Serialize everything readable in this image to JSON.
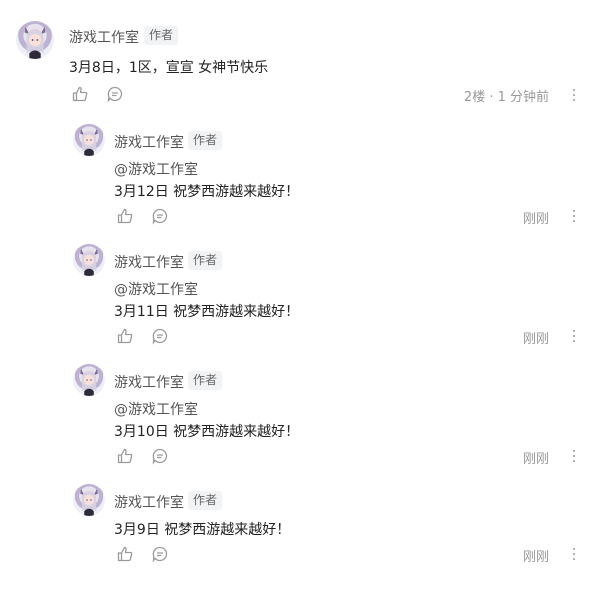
{
  "comments": [
    {
      "author": "游戏工作室",
      "badge": "作者",
      "mention": "",
      "text": "3月8日，1区，宣宣   女神节快乐",
      "meta": "2楼 · 1 分钟前",
      "icons": [
        "like-icon",
        "reply-icon",
        "more-options-icon"
      ]
    }
  ],
  "replies": [
    {
      "author": "游戏工作室",
      "badge": "作者",
      "mention": "@游戏工作室",
      "text": "3月12日  祝梦西游越来越好！",
      "meta": "刚刚"
    },
    {
      "author": "游戏工作室",
      "badge": "作者",
      "mention": "@游戏工作室",
      "text": "3月11日  祝梦西游越来越好！",
      "meta": "刚刚"
    },
    {
      "author": "游戏工作室",
      "badge": "作者",
      "mention": "@游戏工作室",
      "text": "3月10日  祝梦西游越来越好！",
      "meta": "刚刚"
    },
    {
      "author": "游戏工作室",
      "badge": "作者",
      "mention": "",
      "text": "3月9日  祝梦西游越来越好！",
      "meta": "刚刚"
    }
  ],
  "colors": {
    "text": "#222222",
    "muted": "#999999",
    "icon": "#9a9a9a",
    "badge_bg": "#f2f3f5"
  }
}
